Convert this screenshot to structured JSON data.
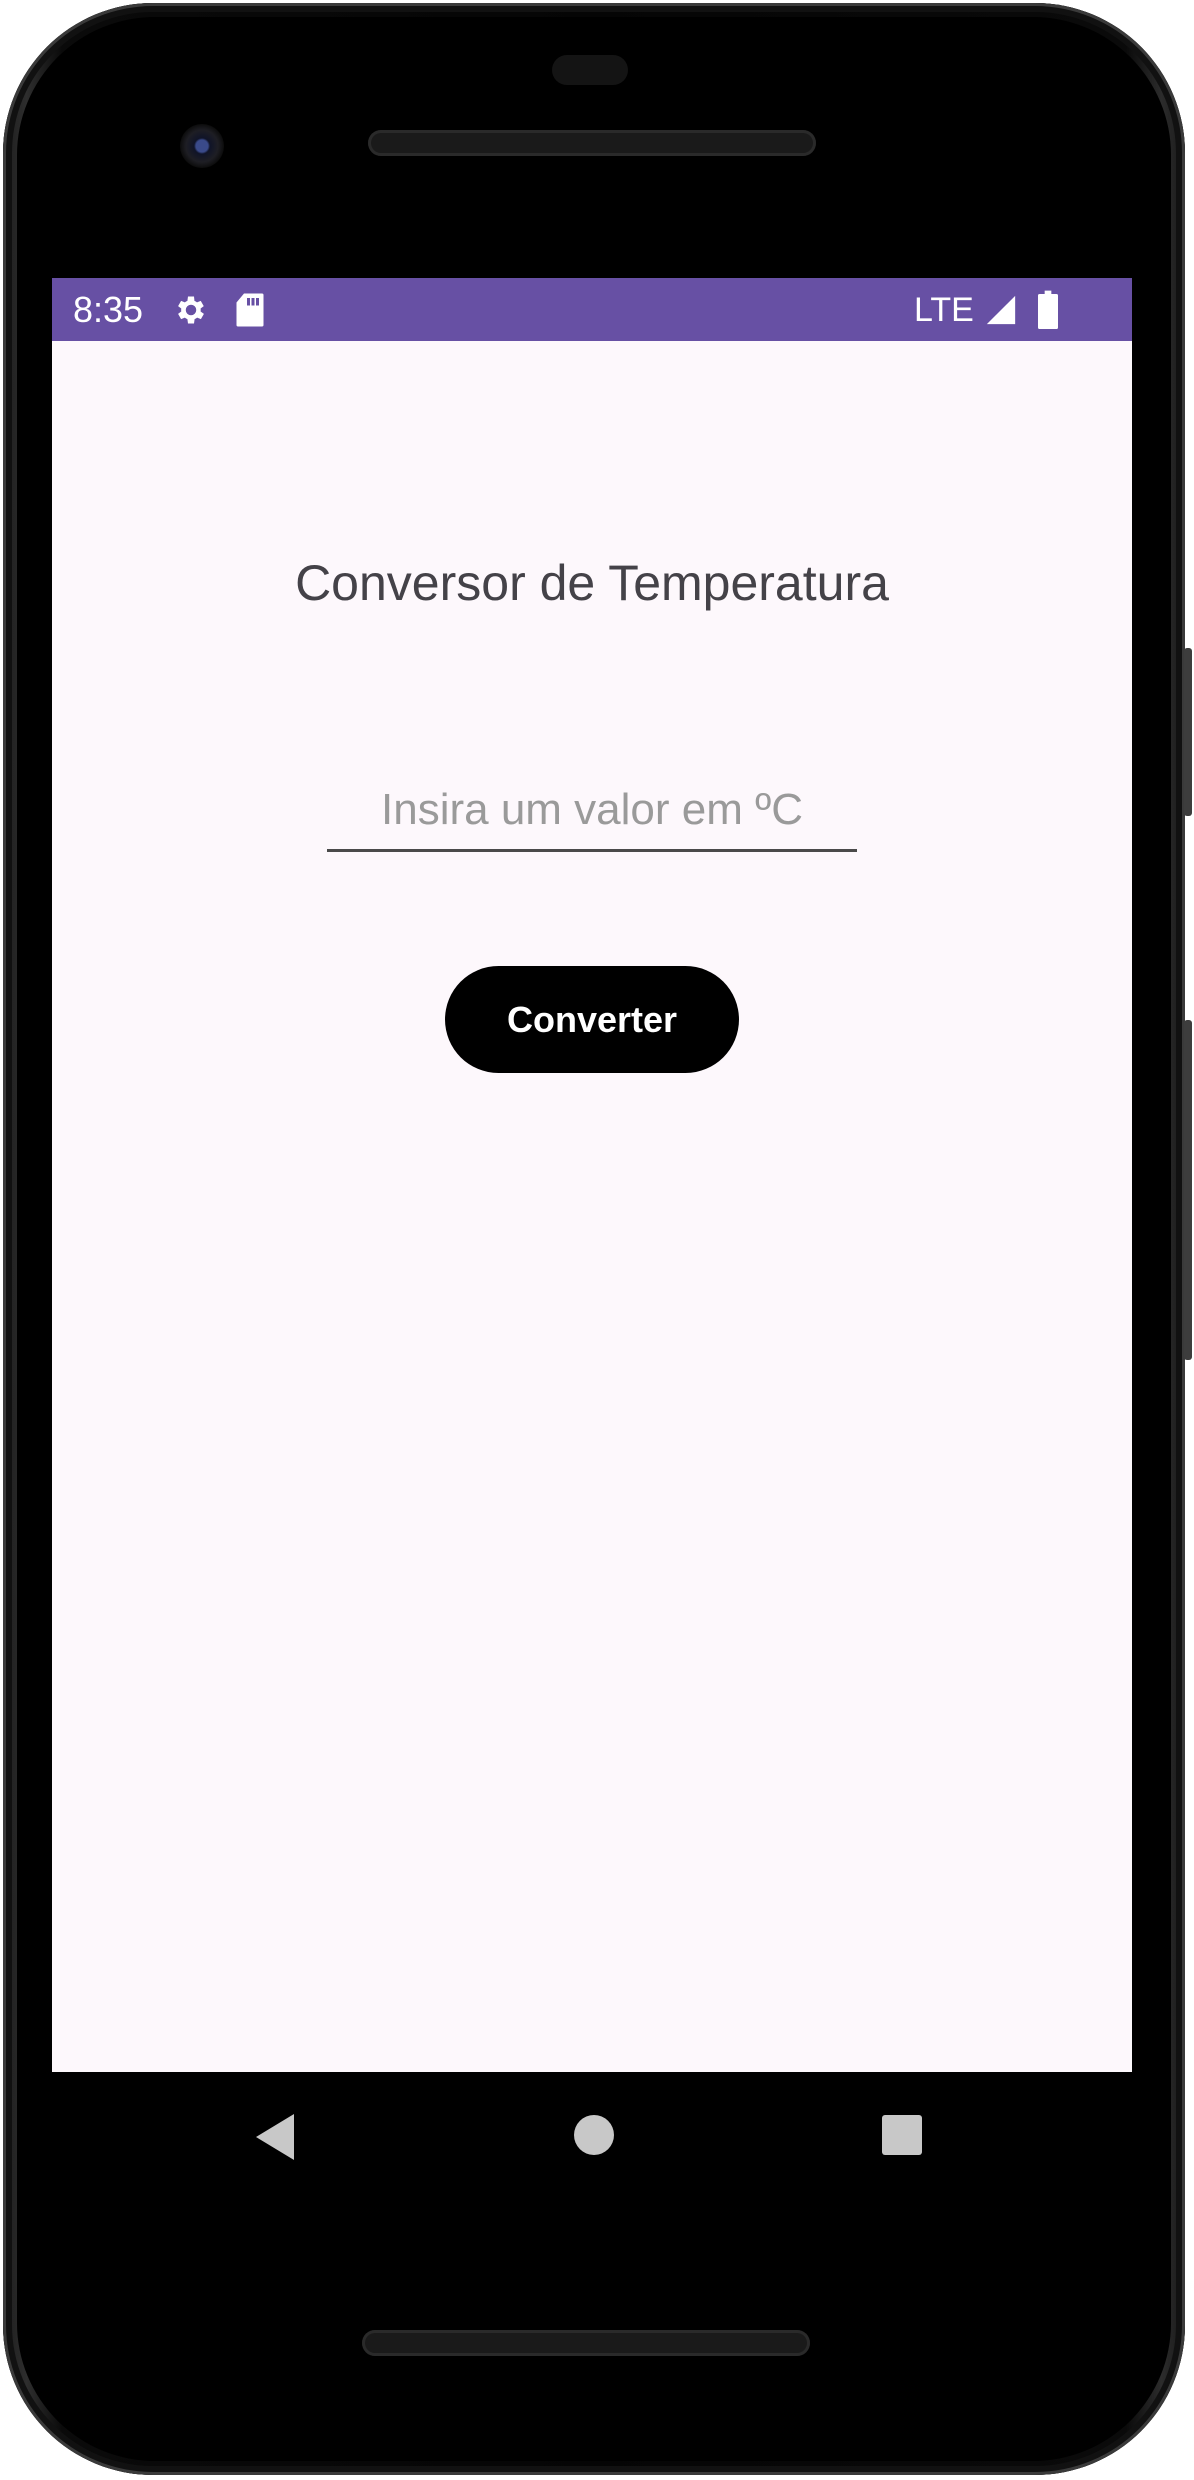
{
  "status_bar": {
    "time": "8:35",
    "network": "LTE",
    "background_color": "#6750a4",
    "icons": [
      "gear-icon",
      "sd-card-icon",
      "signal-icon",
      "battery-icon"
    ]
  },
  "main": {
    "title": "Conversor de Temperatura",
    "input": {
      "value": "",
      "placeholder": "Insira um valor em ºC"
    },
    "convert_button_label": "Converter"
  },
  "nav_bar": {
    "icons": [
      "back-icon",
      "home-icon",
      "recents-icon"
    ]
  },
  "colors": {
    "screen_background": "#fdf8fc",
    "button_background": "#000000",
    "title_text": "#444248"
  }
}
